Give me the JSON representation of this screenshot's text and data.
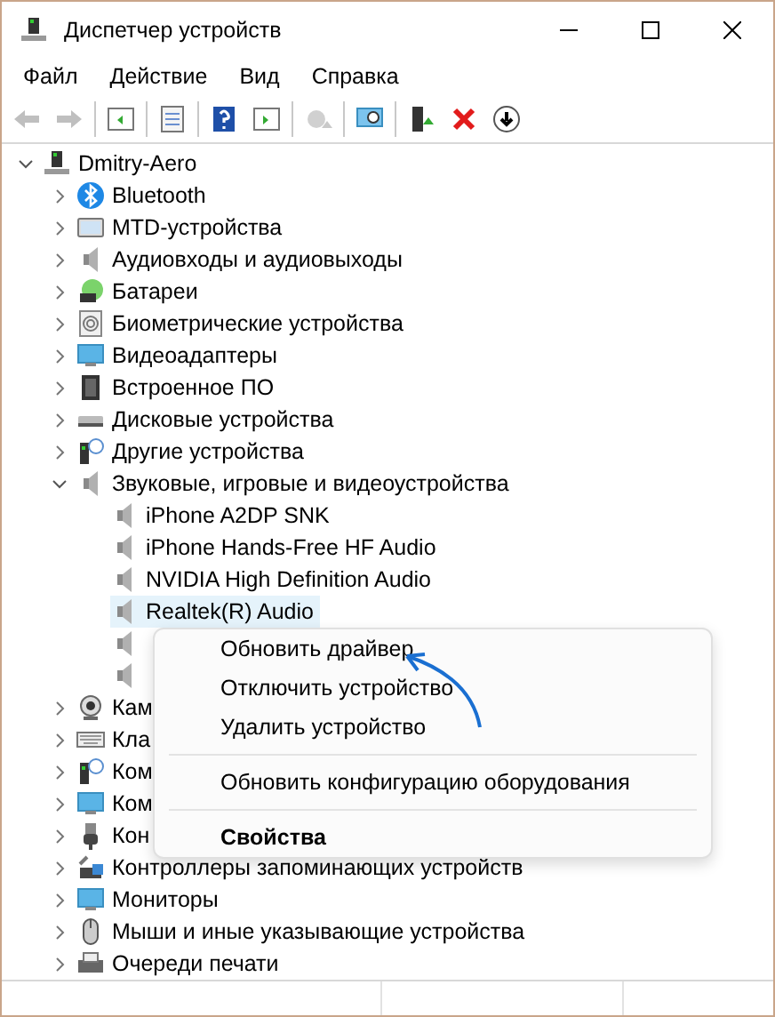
{
  "window": {
    "title": "Диспетчер устройств"
  },
  "menu": [
    "Файл",
    "Действие",
    "Вид",
    "Справка"
  ],
  "toolbar": [
    {
      "disabled": true
    },
    {
      "disabled": true
    },
    {
      "disabled": false
    },
    {
      "disabled": false
    },
    {
      "disabled": false
    },
    {
      "disabled": false
    },
    {
      "disabled": true
    },
    {
      "disabled": false
    },
    {
      "disabled": false
    },
    {
      "disabled": false
    },
    {
      "disabled": false
    }
  ],
  "tree": {
    "label": "Dmitry-Aero",
    "expanded": true,
    "children": [
      {
        "label": "Bluetooth",
        "expanded": false
      },
      {
        "label": "MTD-устройства",
        "expanded": false
      },
      {
        "label": "Аудиовходы и аудиовыходы",
        "expanded": false
      },
      {
        "label": "Батареи",
        "expanded": false
      },
      {
        "label": "Биометрические устройства",
        "expanded": false
      },
      {
        "label": "Видеоадаптеры",
        "expanded": false
      },
      {
        "label": "Встроенное ПО",
        "expanded": false
      },
      {
        "label": "Дисковые устройства",
        "expanded": false
      },
      {
        "label": "Другие устройства",
        "expanded": false
      },
      {
        "label": "Звуковые, игровые и видеоустройства",
        "expanded": true,
        "children": [
          {
            "label": "iPhone A2DP SNK",
            "selected": false
          },
          {
            "label": "iPhone Hands-Free HF Audio",
            "selected": false
          },
          {
            "label": "NVIDIA High Definition Audio",
            "selected": false
          },
          {
            "label": "Realtek(R) Audio",
            "selected": true
          },
          {
            "selected": false
          },
          {
            "selected": false
          }
        ]
      },
      {
        "label": "Кам",
        "expanded": false
      },
      {
        "label": "Кла",
        "expanded": false
      },
      {
        "label": "Ком",
        "expanded": false
      },
      {
        "label": "Ком",
        "expanded": false
      },
      {
        "label": "Кон",
        "expanded": false
      },
      {
        "label": "Контроллеры запоминающих устройств",
        "expanded": false
      },
      {
        "label": "Мониторы",
        "expanded": false
      },
      {
        "label": "Мыши и иные указывающие устройства",
        "expanded": false
      },
      {
        "label": "Очереди печати",
        "expanded": false
      }
    ]
  },
  "context_menu": [
    {
      "kind": "item",
      "label": "Обновить драйвер"
    },
    {
      "kind": "item",
      "label": "Отключить устройство"
    },
    {
      "kind": "item",
      "label": "Удалить устройство"
    },
    {
      "kind": "separator"
    },
    {
      "kind": "item",
      "label": "Обновить конфигурацию оборудования"
    },
    {
      "kind": "separator"
    },
    {
      "kind": "default",
      "label": "Свойства"
    }
  ]
}
